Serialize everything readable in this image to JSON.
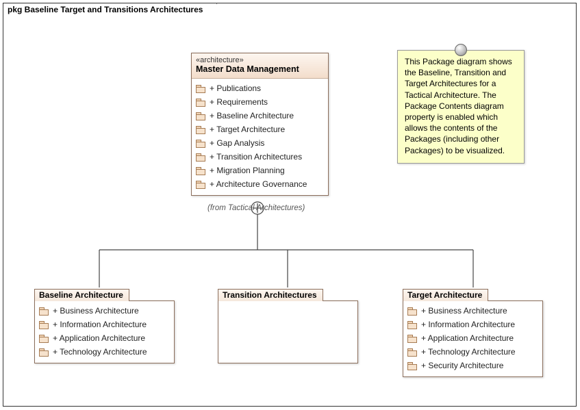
{
  "frame": {
    "title": "pkg Baseline Target and Transitions Architectures"
  },
  "master": {
    "stereotype": "«architecture»",
    "title": "Master Data Management",
    "from": "(from Tactical Architectures)",
    "items": [
      "+ Publications",
      "+ Requirements",
      "+ Baseline Architecture",
      "+ Target Architecture",
      "+ Gap Analysis",
      "+ Transition Architectures",
      "+ Migration Planning",
      "+ Architecture Governance"
    ]
  },
  "baseline": {
    "title": "Baseline Architecture",
    "items": [
      "+ Business Architecture",
      "+ Information Architecture",
      "+ Application Architecture",
      "+ Technology Architecture"
    ]
  },
  "transition": {
    "title": "Transition Architectures"
  },
  "target": {
    "title": "Target Architecture",
    "items": [
      "+ Business Architecture",
      "+ Information Architecture",
      "+ Application Architecture",
      "+ Technology Architecture",
      "+ Security Architecture"
    ]
  },
  "note": {
    "text": "This Package diagram shows the Baseline, Transition and Target Architectures for a Tactical Architecture. The Package Contents diagram property is enabled which allows the contents of the Packages (including other Packages) to be visualized."
  }
}
